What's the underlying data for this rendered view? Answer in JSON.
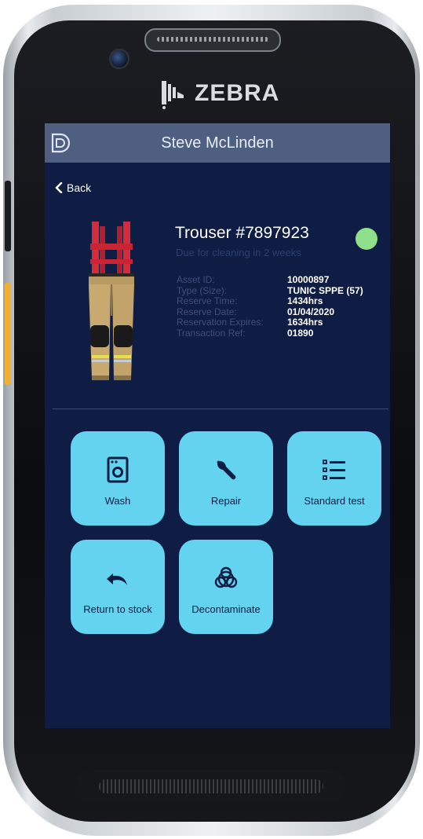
{
  "device": {
    "brand": "ZEBRA",
    "brand_icon": "zebra-head-icon"
  },
  "header": {
    "title": "Steve McLinden",
    "logo_icon": "app-logo-icon"
  },
  "nav": {
    "back_label": "Back",
    "back_icon": "chevron-left-icon"
  },
  "asset": {
    "title": "Trouser #7897923",
    "subtitle": "Due for cleaning in 2 weeks",
    "status_color": "#8fe08a",
    "details": [
      {
        "label": "Asset ID:",
        "value": "10000897"
      },
      {
        "label": "Type (Size):",
        "value": "TUNIC SPPE (57)"
      },
      {
        "label": "Reserve Time:",
        "value": "1434hrs"
      },
      {
        "label": "Reserve Date:",
        "value": "01/04/2020"
      },
      {
        "label": "Reservation Expires:",
        "value": "1634hrs"
      },
      {
        "label": "Transaction Ref:",
        "value": "01890"
      }
    ]
  },
  "actions": [
    {
      "label": "Wash",
      "icon": "washing-machine-icon"
    },
    {
      "label": "Repair",
      "icon": "wrench-icon"
    },
    {
      "label": "Standard test",
      "icon": "checklist-icon"
    },
    {
      "label": "Return to stock",
      "icon": "undo-icon"
    },
    {
      "label": "Decontaminate",
      "icon": "biohazard-icon"
    }
  ],
  "colors": {
    "screen_bg": "#0f1d45",
    "header_bg": "#4f5f82",
    "tile_bg": "#63d3ef",
    "accent_status": "#8fe08a"
  }
}
